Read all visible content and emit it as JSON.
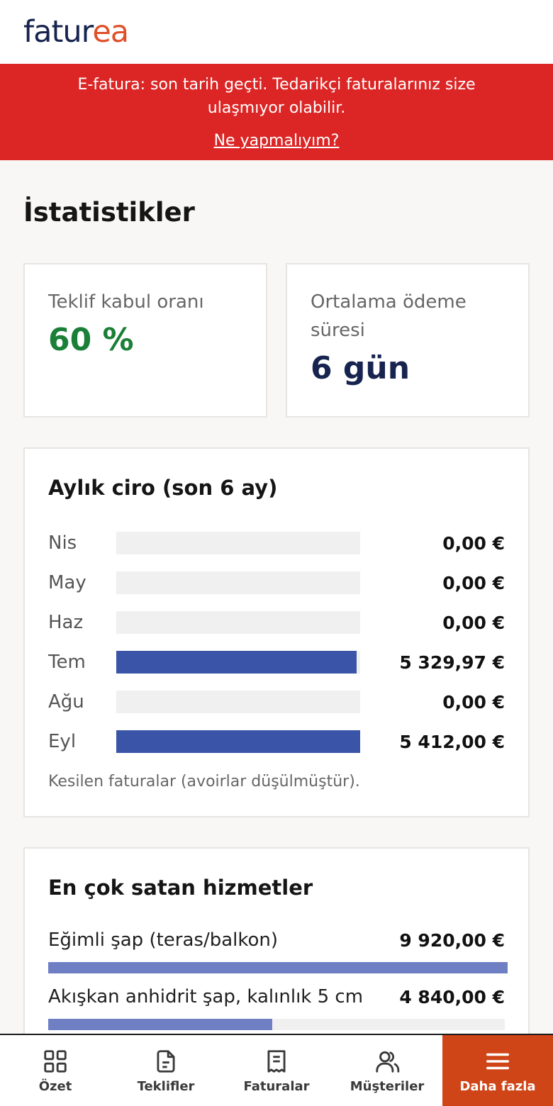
{
  "logo": {
    "part1": "fatur",
    "part2": "ea"
  },
  "alert": {
    "message": "E-fatura: son tarih geçti. Tedarikçi faturalarınız size ulaşmıyor olabilir.",
    "link": "Ne yapmalıyım?"
  },
  "page_title": "İstatistikler",
  "stats": {
    "acceptance": {
      "label": "Teklif kabul oranı",
      "value": "60 %",
      "color": "#1a7f37"
    },
    "payment": {
      "label": "Ortalama ödeme süresi",
      "value": "6 gün",
      "color": "#17244f"
    }
  },
  "revenue": {
    "title": "Aylık ciro (son 6 ay)",
    "note": "Kesilen faturalar (avoirlar düşülmüştür).",
    "rows": [
      {
        "month": "Nis",
        "amount": "0,00 €",
        "value": 0
      },
      {
        "month": "May",
        "amount": "0,00 €",
        "value": 0
      },
      {
        "month": "Haz",
        "amount": "0,00 €",
        "value": 0
      },
      {
        "month": "Tem",
        "amount": "5 329,97 €",
        "value": 5329.97
      },
      {
        "month": "Ağu",
        "amount": "0,00 €",
        "value": 0
      },
      {
        "month": "Eyl",
        "amount": "5 412,00 €",
        "value": 5412.0
      }
    ],
    "max": 5412.0,
    "bar_color": "#3a54a8"
  },
  "services": {
    "title": "En çok satan hizmetler",
    "items": [
      {
        "name": "Eğimli şap (teras/balkon)",
        "amount": "9 920,00 €",
        "value": 9920.0
      },
      {
        "name": "Akışkan anhidrit şap, kalınlık 5 cm",
        "amount": "4 840,00 €",
        "value": 4840.0
      }
    ],
    "max": 9920.0,
    "bar_color": "#6e7fc4"
  },
  "nav": {
    "items": [
      {
        "label": "Özet",
        "icon": "grid-icon"
      },
      {
        "label": "Teklifler",
        "icon": "document-icon"
      },
      {
        "label": "Faturalar",
        "icon": "receipt-icon"
      },
      {
        "label": "Müşteriler",
        "icon": "users-icon"
      },
      {
        "label": "Daha fazla",
        "icon": "menu-icon"
      }
    ],
    "active_color": "#cf4518"
  }
}
